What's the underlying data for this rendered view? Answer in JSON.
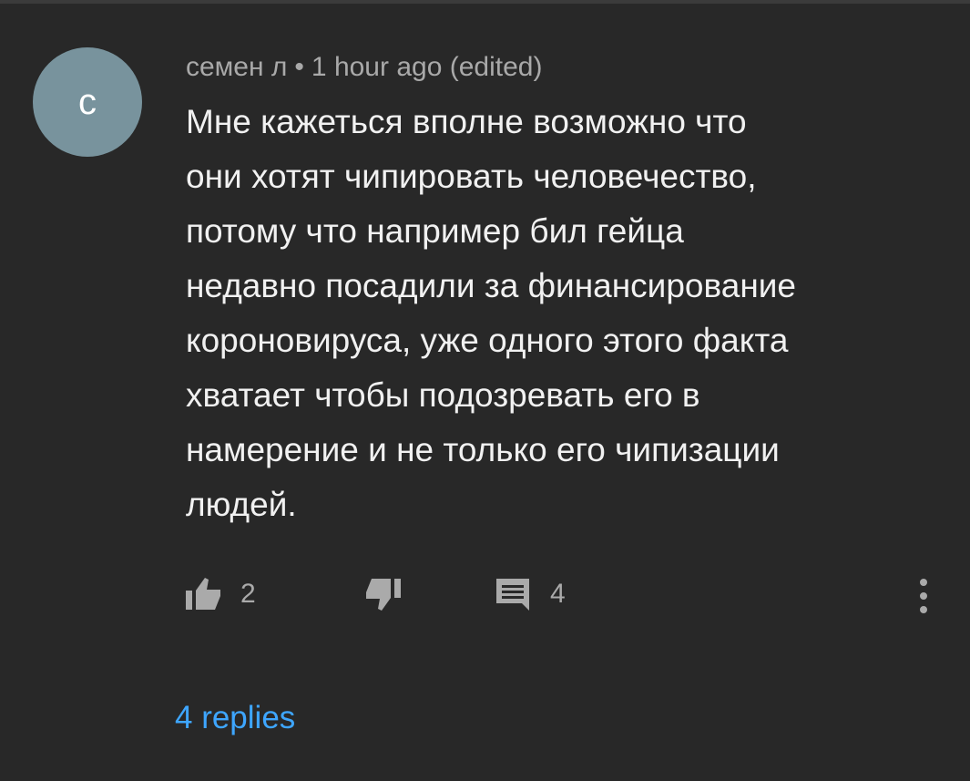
{
  "comment": {
    "avatar_letter": "с",
    "author": "семен л",
    "separator": "•",
    "time": "1 hour ago (edited)",
    "text": "Мне кажеться вполне возможно что\nони хотят чипировать человечество,\nпотому что например бил гейца\nнедавно посадили за финансирование\nкороновируса, уже одного этого факта\nхватает чтобы подозревать  его в\nнамерение и не только его чипизации\nлюдей."
  },
  "actions": {
    "like_icon": "thumb-up-icon",
    "likes_count": "2",
    "dislike_icon": "thumb-down-icon",
    "reply_icon": "comment-icon",
    "replies_count": "4",
    "more_icon": "more-vertical-icon"
  },
  "replies": {
    "label": "4 replies"
  },
  "colors": {
    "background": "#282828",
    "avatar": "#78939d",
    "text": "#f1f1f1",
    "meta": "#a9a9a9",
    "link": "#3ea6ff"
  }
}
